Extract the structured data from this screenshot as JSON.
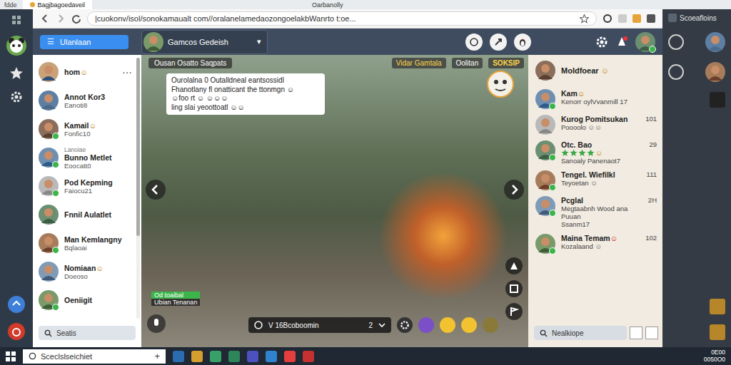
{
  "browser": {
    "corner_label": "fdde",
    "tab_title": "Bagjbagoedaveil",
    "window_title": "Oarbanolly",
    "url": "|cuokonv/isol/sonokamaualt com//oralanelamedaozongoelakbWanrto t:oe..."
  },
  "topbar": {
    "menu_icon": "☰",
    "menu_label": "Ulanlaan",
    "dropdown_label": "Gamcos Gedeish",
    "dropdown_caret": "▾"
  },
  "contacts": {
    "more": "···",
    "search_placeholder": "Seatis",
    "items": [
      {
        "name": "hom",
        "badge": "☺",
        "online": false
      },
      {
        "name": "Annot Kor3",
        "subtitle": "Eanoti8",
        "online": false
      },
      {
        "name": "Kamail",
        "badge": "☺",
        "subtitle": "Fonfic10",
        "online": true
      },
      {
        "tag": "Lanoiae",
        "name": "Bunno Metlet",
        "subtitle": "Eoocatt0",
        "online": true
      },
      {
        "name": "Pod Kepming",
        "subtitle": "Faiocu21",
        "online": true
      },
      {
        "name": "Fnnil Aulatlet",
        "online": false
      },
      {
        "name": "Man Kemlangny",
        "subtitle": "Bqlaoai",
        "online": true
      },
      {
        "name": "Nomiaan",
        "badge": "☺",
        "subtitle": "Doeoso",
        "online": false
      },
      {
        "name": "Oeniigit",
        "online": true
      }
    ]
  },
  "game": {
    "header_left": "Ousan Osatto Saqpats",
    "header_right": [
      "Vidar Gamtala",
      "Oolitan",
      "SOKSIP"
    ],
    "chat_lines": [
      "Ourolalna 0 Outalldneal eantsossidl",
      "Fhanotlany fl onatticant the ttonmgn ☺",
      "☺foo rt ☺ ☺☺☺",
      "ling slai yeoottoatl ☺☺"
    ],
    "label_title": "Od toaibal",
    "label_sub": "Ubian Tenanan",
    "bar_text": "V 16Bcoboomin",
    "bar_count": "2"
  },
  "friends": {
    "header": "Moldfoear",
    "header_badge": "☺",
    "search_placeholder": "Nealkiope",
    "items": [
      {
        "name": "Kam",
        "badge": "☺",
        "kind": "plain",
        "lines": [
          "Kenorr oylVvanrnill 17"
        ],
        "online": true
      },
      {
        "name": "Kurog Pomitsukan",
        "count": "101",
        "kind": "plain",
        "lines": [
          "Poooolo ☺☺"
        ],
        "online": false
      },
      {
        "name": "Otc. Bao",
        "count": "29",
        "kind": "rating",
        "stars": 4,
        "rating_badge": "☺",
        "lines": [
          "Sanoaly Panenaot7"
        ],
        "online": true
      },
      {
        "name": "Tengel. Wiefilkl",
        "count": "111",
        "kind": "plain",
        "lines": [
          "Teyoetan ☺"
        ],
        "online": true
      },
      {
        "name": "Pcglal",
        "count": "2H",
        "kind": "plain",
        "lines": [
          "Megtaabnh Wood ana",
          "Puuan",
          "Ssanm17"
        ],
        "online": true
      },
      {
        "name": "Maina Temam",
        "badge": "☺",
        "count": "102",
        "kind": "plain",
        "lines": [
          "Kozalaand ☺"
        ],
        "online": true
      }
    ]
  },
  "dock": {
    "title": "Scoeafloins"
  },
  "taskbar": {
    "search_placeholder": "Sceclslseichiet",
    "add": "+",
    "time": "0E00",
    "date": "0050O0"
  }
}
